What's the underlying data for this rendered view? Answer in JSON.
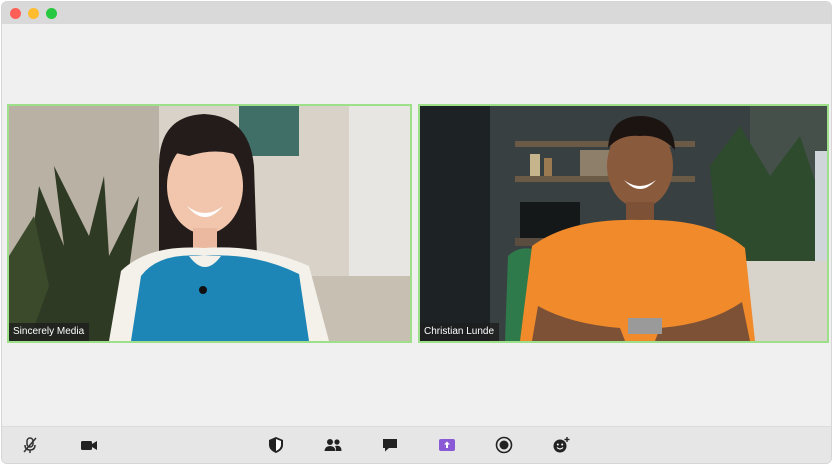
{
  "window": {
    "controls": {
      "close_color": "#ff5f57",
      "minimize_color": "#febc2e",
      "maximize_color": "#28c840"
    }
  },
  "participants": [
    {
      "name": "Sincerely Media",
      "active_border_color": "#9ee08a"
    },
    {
      "name": "Christian Lunde",
      "active_border_color": "#9ee08a"
    }
  ],
  "toolbar": {
    "buttons": [
      {
        "icon": "mic-muted-icon",
        "state": "muted"
      },
      {
        "icon": "video-camera-icon"
      },
      {
        "icon": "security-shield-icon"
      },
      {
        "icon": "participants-icon"
      },
      {
        "icon": "chat-icon"
      },
      {
        "icon": "share-screen-icon",
        "accent": "#8a5ad6"
      },
      {
        "icon": "record-icon"
      },
      {
        "icon": "reactions-icon"
      }
    ]
  }
}
